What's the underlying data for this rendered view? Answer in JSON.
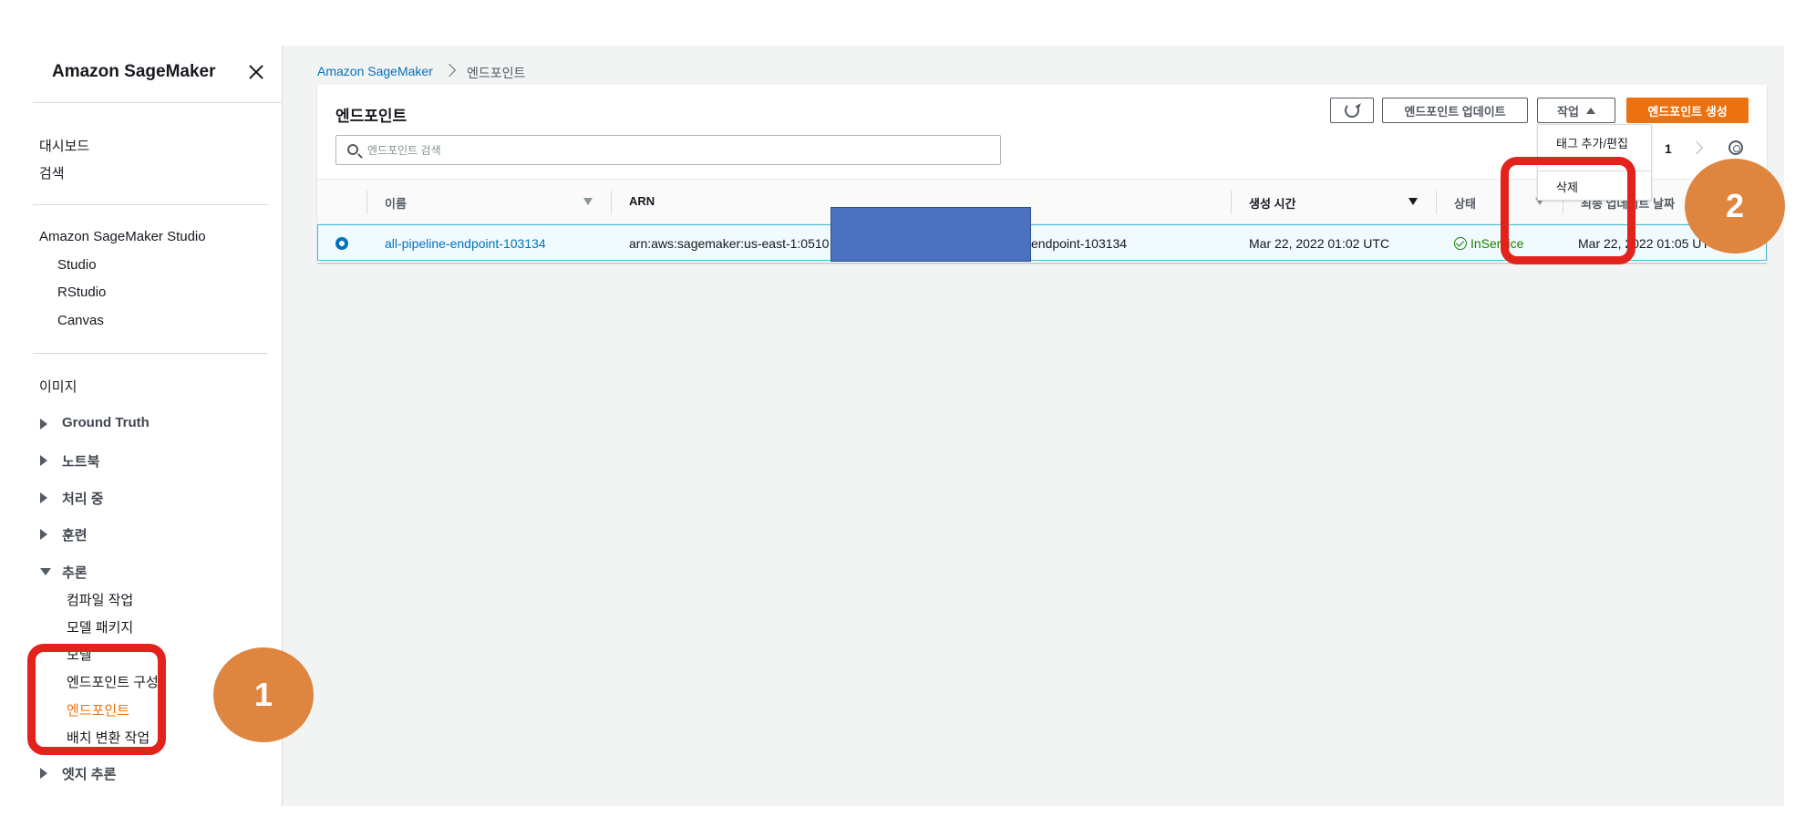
{
  "sidebar": {
    "title": "Amazon SageMaker",
    "top_links": [
      "대시보드",
      "검색"
    ],
    "studio_header": "Amazon SageMaker Studio",
    "studio_items": [
      "Studio",
      "RStudio",
      "Canvas"
    ],
    "images_label": "이미지",
    "groups": {
      "ground_truth": "Ground Truth",
      "notebook": "노트북",
      "processing": "처리 중",
      "training": "훈련",
      "inference": "추론",
      "edge": "엣지 추론"
    },
    "inference_items": [
      "컴파일 작업",
      "모델 패키지",
      "모델",
      "엔드포인트 구성",
      "엔드포인트",
      "배치 변환 작업"
    ]
  },
  "breadcrumb": {
    "root": "Amazon SageMaker",
    "current": "엔드포인트"
  },
  "panel": {
    "title": "엔드포인트",
    "update_button": "엔드포인트 업데이트",
    "actions_button": "작업",
    "create_button": "엔드포인트 생성",
    "search_placeholder": "엔드포인트 검색",
    "page": "1"
  },
  "actions_menu": {
    "items": [
      "태그 추가/편집",
      "삭제"
    ]
  },
  "table": {
    "columns": [
      "이름",
      "ARN",
      "생성 시간",
      "상태",
      "최종 업데이트 날짜"
    ],
    "rows": [
      {
        "name": "all-pipeline-endpoint-103134",
        "arn_prefix": "arn:aws:sagemaker:us-east-1:0510",
        "arn_suffix": "endpoint-103134",
        "created": "Mar 22, 2022 01:02 UTC",
        "status": "InService",
        "updated": "Mar 22, 2022 01:05 UTC"
      }
    ]
  },
  "annotations": {
    "badge_1": "1",
    "badge_2": "2",
    "badge_color": "#de8540",
    "highlight_color": "#e3231b"
  },
  "colors": {
    "accent": "#ec7211",
    "link": "#0073bb",
    "status_ok": "#1d8102",
    "redaction": "#4b72c0"
  }
}
